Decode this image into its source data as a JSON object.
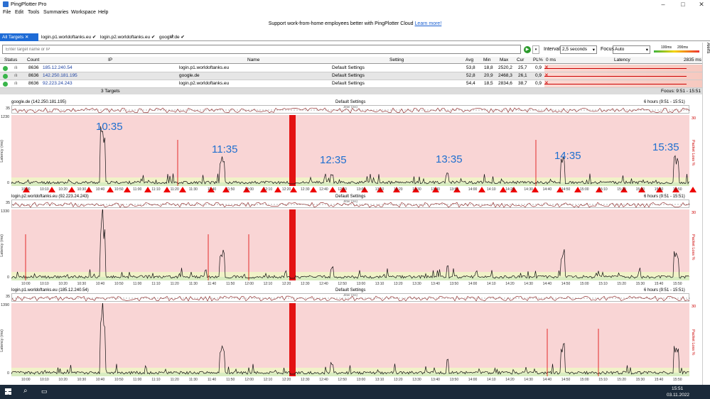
{
  "window": {
    "title": "PingPlotter Pro"
  },
  "menu": [
    "File",
    "Edit",
    "Tools",
    "Summaries",
    "Workspace",
    "Help"
  ],
  "promo": {
    "text": "Support work-from-home employees better with PingPlotter Cloud",
    "link": "Learn more!"
  },
  "tabs": {
    "all": "All Targets",
    "items": [
      "login.p1.worldoftanks.eu",
      "login.p2.worldoftanks.eu",
      "google.de"
    ]
  },
  "toolbar": {
    "placeholder": "Enter target name or IP",
    "interval_label": "Interval",
    "interval": "2,5 seconds",
    "focus_label": "Focus",
    "focus": "Auto",
    "scale_a": "100ms",
    "scale_b": "200ms"
  },
  "alerts_label": "Alerts",
  "columns": {
    "status": "Status",
    "count": "Count",
    "ip": "IP",
    "name": "Name",
    "setting": "Setting",
    "avg": "Avg",
    "min": "Min",
    "max": "Max",
    "cur": "Cur",
    "pl": "PL%",
    "zero": "0 ms",
    "latency": "Latency",
    "maxms": "2835 ms"
  },
  "rows": [
    {
      "count": "8636",
      "ip": "185.12.240.54",
      "name": "login.p1.worldoftanks.eu",
      "setting": "Default Settings",
      "avg": "53,8",
      "min": "18,8",
      "max": "2520,2",
      "cur": "25,7",
      "pl": "0,9"
    },
    {
      "count": "8636",
      "ip": "142.250.181.195",
      "name": "google.de",
      "setting": "Default Settings",
      "avg": "52,8",
      "min": "20,9",
      "max": "2468,3",
      "cur": "26,1",
      "pl": "0,9"
    },
    {
      "count": "8636",
      "ip": "92.223.24.243",
      "name": "login.p2.worldoftanks.eu",
      "setting": "Default Settings",
      "avg": "54,4",
      "min": "18,5",
      "max": "2834,6",
      "cur": "38,7",
      "pl": "0,9"
    }
  ],
  "summary": {
    "targets": "3 Targets",
    "focus": "Focus: 9:51 - 15:51"
  },
  "graphs": [
    {
      "title": "google.de (142.250.181.195)",
      "setting": "Default Settings",
      "range": "6 hours (9:51 - 15:51)",
      "ymax": "1230",
      "jitter_y": "35"
    },
    {
      "title": "login.p2.worldoftanks.eu (92.223.24.243)",
      "setting": "Default Settings",
      "range": "6 hours (9:51 - 15:51)",
      "ymax": "1330",
      "jitter_y": "35"
    },
    {
      "title": "login.p1.worldoftanks.eu (185.12.240.54)",
      "setting": "Default Settings",
      "range": "6 hours (9:51 - 15:51)",
      "ymax": "1390",
      "jitter_y": "35"
    }
  ],
  "axis_labels": {
    "latency": "Latency (ms)",
    "packet_loss": "Packet Loss %",
    "pl_max": "30",
    "jitter": "Jitter (ms)",
    "zero": "0"
  },
  "xticks": [
    "10:00",
    "10:10",
    "10:20",
    "10:30",
    "10:40",
    "10:50",
    "11:00",
    "11:10",
    "11:20",
    "11:30",
    "11:40",
    "11:50",
    "12:00",
    "12:10",
    "12:20",
    "12:30",
    "12:40",
    "12:50",
    "13:00",
    "13:10",
    "13:20",
    "13:30",
    "13:40",
    "13:50",
    "14:00",
    "14:10",
    "14:20",
    "14:30",
    "14:40",
    "14:50",
    "15:00",
    "15:10",
    "15:20",
    "15:30",
    "15:40",
    "15:50"
  ],
  "annotations": [
    "10:35",
    "11:35",
    "12:35",
    "13:35",
    "14:35",
    "15:35"
  ],
  "taskbar": {
    "time": "15:51",
    "date": "03.11.2022"
  }
}
